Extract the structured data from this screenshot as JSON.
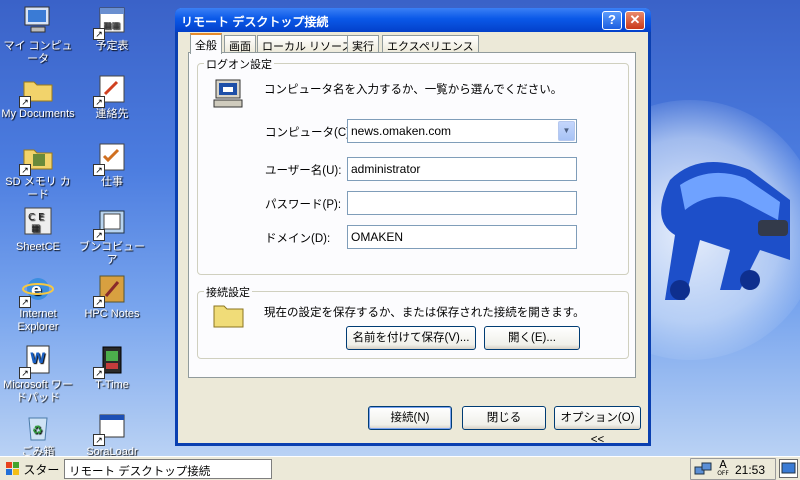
{
  "desktop": {
    "icons": [
      {
        "label": "マイ コンピュータ",
        "icon": "computer-icon"
      },
      {
        "label": "予定表",
        "icon": "calendar-icon"
      },
      {
        "label": "My Documents",
        "icon": "folder-icon"
      },
      {
        "label": "連絡先",
        "icon": "contacts-icon"
      },
      {
        "label": "SD メモリ カード",
        "icon": "sd-card-icon"
      },
      {
        "label": "仕事",
        "icon": "tasks-icon"
      },
      {
        "label": "SheetCE",
        "icon": "sheetce-icon"
      },
      {
        "label": "ブンコビューア",
        "icon": "book-viewer-icon"
      },
      {
        "label": "Internet Explorer",
        "icon": "internet-explorer-icon"
      },
      {
        "label": "HPC Notes",
        "icon": "notes-icon"
      },
      {
        "label": "Microsoft ワードパッド",
        "icon": "wordpad-icon"
      },
      {
        "label": "T-Time",
        "icon": "t-time-icon"
      },
      {
        "label": "ごみ箱",
        "icon": "recycle-bin-icon"
      },
      {
        "label": "SoraLoadr",
        "icon": "app-window-icon"
      }
    ]
  },
  "dialog": {
    "title": "リモート デスクトップ接続",
    "help_glyph": "?",
    "close_glyph": "✕",
    "tabs": [
      "全般",
      "画面",
      "ローカル リソース",
      "実行",
      "エクスペリエンス"
    ],
    "logon": {
      "group_title": "ログオン設定",
      "intro": "コンピュータ名を入力するか、一覧から選んでください。",
      "computer_label": "コンピュータ(C):",
      "computer_value": "news.omaken.com",
      "user_label": "ユーザー名(U):",
      "user_value": "administrator",
      "password_label": "パスワード(P):",
      "password_value": "",
      "domain_label": "ドメイン(D):",
      "domain_value": "OMAKEN"
    },
    "connection": {
      "group_title": "接続設定",
      "intro": "現在の設定を保存するか、または保存された接続を開きます。",
      "save_as_label": "名前を付けて保存(V)...",
      "open_label": "開く(E)..."
    },
    "buttons": {
      "connect": "接続(N)",
      "close": "閉じる",
      "options": "オプション(O) <<"
    }
  },
  "taskbar": {
    "start_label": "スタート",
    "task_label": "リモート デスクトップ接続",
    "clock": "21:53",
    "ime_label": "A",
    "ime_sub": "OFF"
  },
  "colors": {
    "title_bar": "#0a58e8",
    "dialog_bg": "#ece9d8",
    "tab_accent": "#e68b2c"
  }
}
